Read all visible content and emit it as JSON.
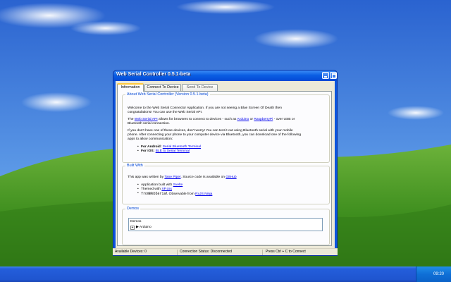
{
  "window": {
    "title": "Web Serial Controller 0.5.1-beta"
  },
  "tabs": [
    {
      "label": "Information",
      "active": true
    },
    {
      "label": "Connect To Device",
      "active": false
    },
    {
      "label": "Send To Device",
      "active": false
    }
  ],
  "about": {
    "legend": "About Web Serial Controller (Version 0.5.1-beta)",
    "p1_line1": "Welcome to the Web Serial Connector Application. If you are not seeing a Blue Screen Of Death then",
    "p1_line2": "congratulations! You can use the Web Serial API.",
    "p2_pre": "The ",
    "p2_link1": "Web Serial API",
    "p2_mid": " allows for browsers to connect to devices - such as ",
    "p2_link2": "Arduino",
    "p2_or": " or ",
    "p2_link3": "RaspberryPi",
    "p2_post": " - over USB or",
    "p2_line2": "Bluetooth serial connection.",
    "p3_line1": "If you don't have one of these devices, don't worry! You can test it out using Bluetooth serial with your mobile",
    "p3_line2": "phone. After connecting your phone to your computer device via Bluetooth, you can download one of the following",
    "p3_line3": "apps to allow communication:",
    "android_label": "For Android:",
    "android_link": "Serial Bluetooth Terminal",
    "ios_label": "For iOS:",
    "ios_link": "BLE to Serial Terminal"
  },
  "built": {
    "legend": "Built With",
    "line1_pre": "This app was written by ",
    "line1_link1": "Tane Piper",
    "line1_mid": ". Source code is available on ",
    "line1_link2": "GitHub",
    "item1_pre": "Application built with ",
    "item1_link": "Svelte",
    "item2_pre": "Themed with ",
    "item2_link": "XP.css",
    "item3_code": "fromWebSerial",
    "item3_mid": " Observable from ",
    "item3_link": "RxJS Ninja"
  },
  "demos": {
    "legend": "Demos",
    "header": "Demos",
    "item": "Arduino",
    "expander": "+"
  },
  "statusbar": {
    "devices": "Available Devices: 0",
    "connection": "Connection Status: Disconnected",
    "hint": "Press Ctrl + C to Connect"
  },
  "taskbar": {
    "clock": "09:20"
  }
}
